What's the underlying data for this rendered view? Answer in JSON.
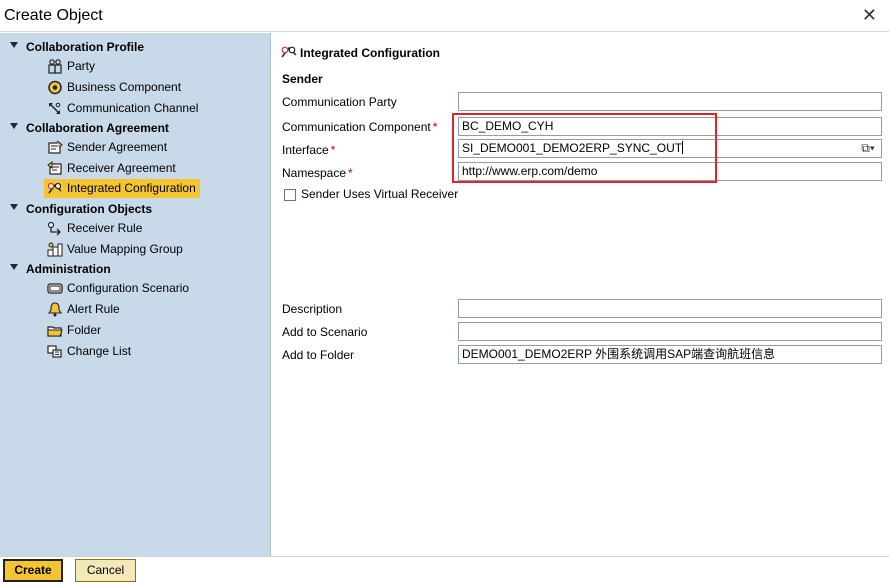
{
  "window": {
    "title": "Create Object"
  },
  "sidebar": {
    "groups": [
      {
        "label": "Collaboration Profile",
        "items": [
          {
            "label": "Party",
            "icon": "party-icon"
          },
          {
            "label": "Business Component",
            "icon": "business-component-icon"
          },
          {
            "label": "Communication Channel",
            "icon": "communication-channel-icon"
          }
        ]
      },
      {
        "label": "Collaboration Agreement",
        "items": [
          {
            "label": "Sender Agreement",
            "icon": "sender-agreement-icon"
          },
          {
            "label": "Receiver Agreement",
            "icon": "receiver-agreement-icon"
          },
          {
            "label": "Integrated Configuration",
            "icon": "integrated-configuration-icon",
            "selected": true
          }
        ]
      },
      {
        "label": "Configuration Objects",
        "items": [
          {
            "label": "Receiver Rule",
            "icon": "receiver-rule-icon"
          },
          {
            "label": "Value Mapping Group",
            "icon": "value-mapping-group-icon"
          }
        ]
      },
      {
        "label": "Administration",
        "items": [
          {
            "label": "Configuration Scenario",
            "icon": "configuration-scenario-icon"
          },
          {
            "label": "Alert Rule",
            "icon": "alert-rule-icon"
          },
          {
            "label": "Folder",
            "icon": "folder-icon"
          },
          {
            "label": "Change List",
            "icon": "change-list-icon"
          }
        ]
      }
    ]
  },
  "main": {
    "section_title": "Integrated Configuration",
    "sender_heading": "Sender",
    "fields": {
      "communication_party": {
        "label": "Communication Party",
        "value": ""
      },
      "communication_component": {
        "label": "Communication Component",
        "value": "BC_DEMO_CYH",
        "required": "*"
      },
      "interface": {
        "label": "Interface",
        "value": "SI_DEMO001_DEMO2ERP_SYNC_OUT",
        "required": "*"
      },
      "namespace": {
        "label": "Namespace",
        "value": "http://www.erp.com/demo",
        "required": "*"
      },
      "description": {
        "label": "Description",
        "value": ""
      },
      "add_to_scenario": {
        "label": "Add to Scenario",
        "value": ""
      },
      "add_to_folder": {
        "label": "Add to Folder",
        "value": "DEMO001_DEMO2ERP 外围系统调用SAP端查询航班信息"
      }
    },
    "virtual_receiver_label": "Sender Uses Virtual Receiver",
    "highlight_color": "#e0242b"
  },
  "footer": {
    "create_label": "Create",
    "cancel_label": "Cancel"
  },
  "colors": {
    "sidebar_bg": "#c8d9ea",
    "selected_bg": "#f5c431",
    "cancel_bg": "#f3e8b8"
  }
}
